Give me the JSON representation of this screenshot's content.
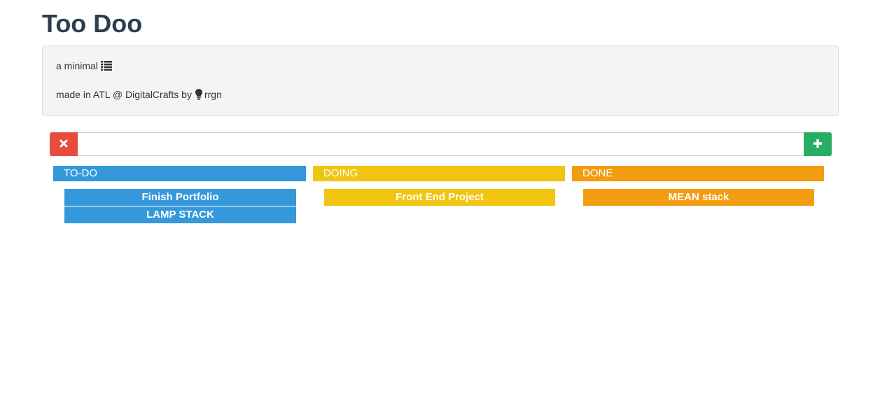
{
  "app": {
    "title": "Too Doo"
  },
  "info": {
    "tagline": "a minimal",
    "tagline_icon": "list-icon",
    "credit_prefix": "made in ATL @ DigitalCrafts by",
    "credit_icon": "lightbulb-icon",
    "credit_author": "rrgn"
  },
  "task_bar": {
    "clear_icon": "close-icon",
    "add_icon": "plus-icon",
    "input_value": "",
    "colors": {
      "clear": "#e74c3c",
      "add": "#27ae60"
    }
  },
  "columns": [
    {
      "title": "TO-DO",
      "color": "#3498db",
      "items": [
        "Finish Portfolio",
        "LAMP STACK"
      ]
    },
    {
      "title": "DOING",
      "color": "#f1c40f",
      "items": [
        "Front End Project"
      ]
    },
    {
      "title": "DONE",
      "color": "#f39c12",
      "items": [
        "MEAN stack"
      ]
    }
  ]
}
